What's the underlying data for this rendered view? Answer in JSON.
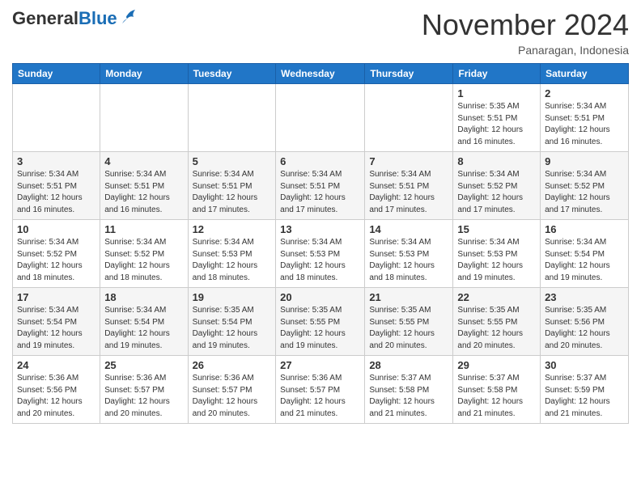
{
  "header": {
    "logo_general": "General",
    "logo_blue": "Blue",
    "month_title": "November 2024",
    "location": "Panaragan, Indonesia"
  },
  "weekdays": [
    "Sunday",
    "Monday",
    "Tuesday",
    "Wednesday",
    "Thursday",
    "Friday",
    "Saturday"
  ],
  "weeks": [
    [
      {
        "day": "",
        "info": ""
      },
      {
        "day": "",
        "info": ""
      },
      {
        "day": "",
        "info": ""
      },
      {
        "day": "",
        "info": ""
      },
      {
        "day": "",
        "info": ""
      },
      {
        "day": "1",
        "info": "Sunrise: 5:35 AM\nSunset: 5:51 PM\nDaylight: 12 hours\nand 16 minutes."
      },
      {
        "day": "2",
        "info": "Sunrise: 5:34 AM\nSunset: 5:51 PM\nDaylight: 12 hours\nand 16 minutes."
      }
    ],
    [
      {
        "day": "3",
        "info": "Sunrise: 5:34 AM\nSunset: 5:51 PM\nDaylight: 12 hours\nand 16 minutes."
      },
      {
        "day": "4",
        "info": "Sunrise: 5:34 AM\nSunset: 5:51 PM\nDaylight: 12 hours\nand 16 minutes."
      },
      {
        "day": "5",
        "info": "Sunrise: 5:34 AM\nSunset: 5:51 PM\nDaylight: 12 hours\nand 17 minutes."
      },
      {
        "day": "6",
        "info": "Sunrise: 5:34 AM\nSunset: 5:51 PM\nDaylight: 12 hours\nand 17 minutes."
      },
      {
        "day": "7",
        "info": "Sunrise: 5:34 AM\nSunset: 5:51 PM\nDaylight: 12 hours\nand 17 minutes."
      },
      {
        "day": "8",
        "info": "Sunrise: 5:34 AM\nSunset: 5:52 PM\nDaylight: 12 hours\nand 17 minutes."
      },
      {
        "day": "9",
        "info": "Sunrise: 5:34 AM\nSunset: 5:52 PM\nDaylight: 12 hours\nand 17 minutes."
      }
    ],
    [
      {
        "day": "10",
        "info": "Sunrise: 5:34 AM\nSunset: 5:52 PM\nDaylight: 12 hours\nand 18 minutes."
      },
      {
        "day": "11",
        "info": "Sunrise: 5:34 AM\nSunset: 5:52 PM\nDaylight: 12 hours\nand 18 minutes."
      },
      {
        "day": "12",
        "info": "Sunrise: 5:34 AM\nSunset: 5:53 PM\nDaylight: 12 hours\nand 18 minutes."
      },
      {
        "day": "13",
        "info": "Sunrise: 5:34 AM\nSunset: 5:53 PM\nDaylight: 12 hours\nand 18 minutes."
      },
      {
        "day": "14",
        "info": "Sunrise: 5:34 AM\nSunset: 5:53 PM\nDaylight: 12 hours\nand 18 minutes."
      },
      {
        "day": "15",
        "info": "Sunrise: 5:34 AM\nSunset: 5:53 PM\nDaylight: 12 hours\nand 19 minutes."
      },
      {
        "day": "16",
        "info": "Sunrise: 5:34 AM\nSunset: 5:54 PM\nDaylight: 12 hours\nand 19 minutes."
      }
    ],
    [
      {
        "day": "17",
        "info": "Sunrise: 5:34 AM\nSunset: 5:54 PM\nDaylight: 12 hours\nand 19 minutes."
      },
      {
        "day": "18",
        "info": "Sunrise: 5:34 AM\nSunset: 5:54 PM\nDaylight: 12 hours\nand 19 minutes."
      },
      {
        "day": "19",
        "info": "Sunrise: 5:35 AM\nSunset: 5:54 PM\nDaylight: 12 hours\nand 19 minutes."
      },
      {
        "day": "20",
        "info": "Sunrise: 5:35 AM\nSunset: 5:55 PM\nDaylight: 12 hours\nand 19 minutes."
      },
      {
        "day": "21",
        "info": "Sunrise: 5:35 AM\nSunset: 5:55 PM\nDaylight: 12 hours\nand 20 minutes."
      },
      {
        "day": "22",
        "info": "Sunrise: 5:35 AM\nSunset: 5:55 PM\nDaylight: 12 hours\nand 20 minutes."
      },
      {
        "day": "23",
        "info": "Sunrise: 5:35 AM\nSunset: 5:56 PM\nDaylight: 12 hours\nand 20 minutes."
      }
    ],
    [
      {
        "day": "24",
        "info": "Sunrise: 5:36 AM\nSunset: 5:56 PM\nDaylight: 12 hours\nand 20 minutes."
      },
      {
        "day": "25",
        "info": "Sunrise: 5:36 AM\nSunset: 5:57 PM\nDaylight: 12 hours\nand 20 minutes."
      },
      {
        "day": "26",
        "info": "Sunrise: 5:36 AM\nSunset: 5:57 PM\nDaylight: 12 hours\nand 20 minutes."
      },
      {
        "day": "27",
        "info": "Sunrise: 5:36 AM\nSunset: 5:57 PM\nDaylight: 12 hours\nand 21 minutes."
      },
      {
        "day": "28",
        "info": "Sunrise: 5:37 AM\nSunset: 5:58 PM\nDaylight: 12 hours\nand 21 minutes."
      },
      {
        "day": "29",
        "info": "Sunrise: 5:37 AM\nSunset: 5:58 PM\nDaylight: 12 hours\nand 21 minutes."
      },
      {
        "day": "30",
        "info": "Sunrise: 5:37 AM\nSunset: 5:59 PM\nDaylight: 12 hours\nand 21 minutes."
      }
    ]
  ]
}
